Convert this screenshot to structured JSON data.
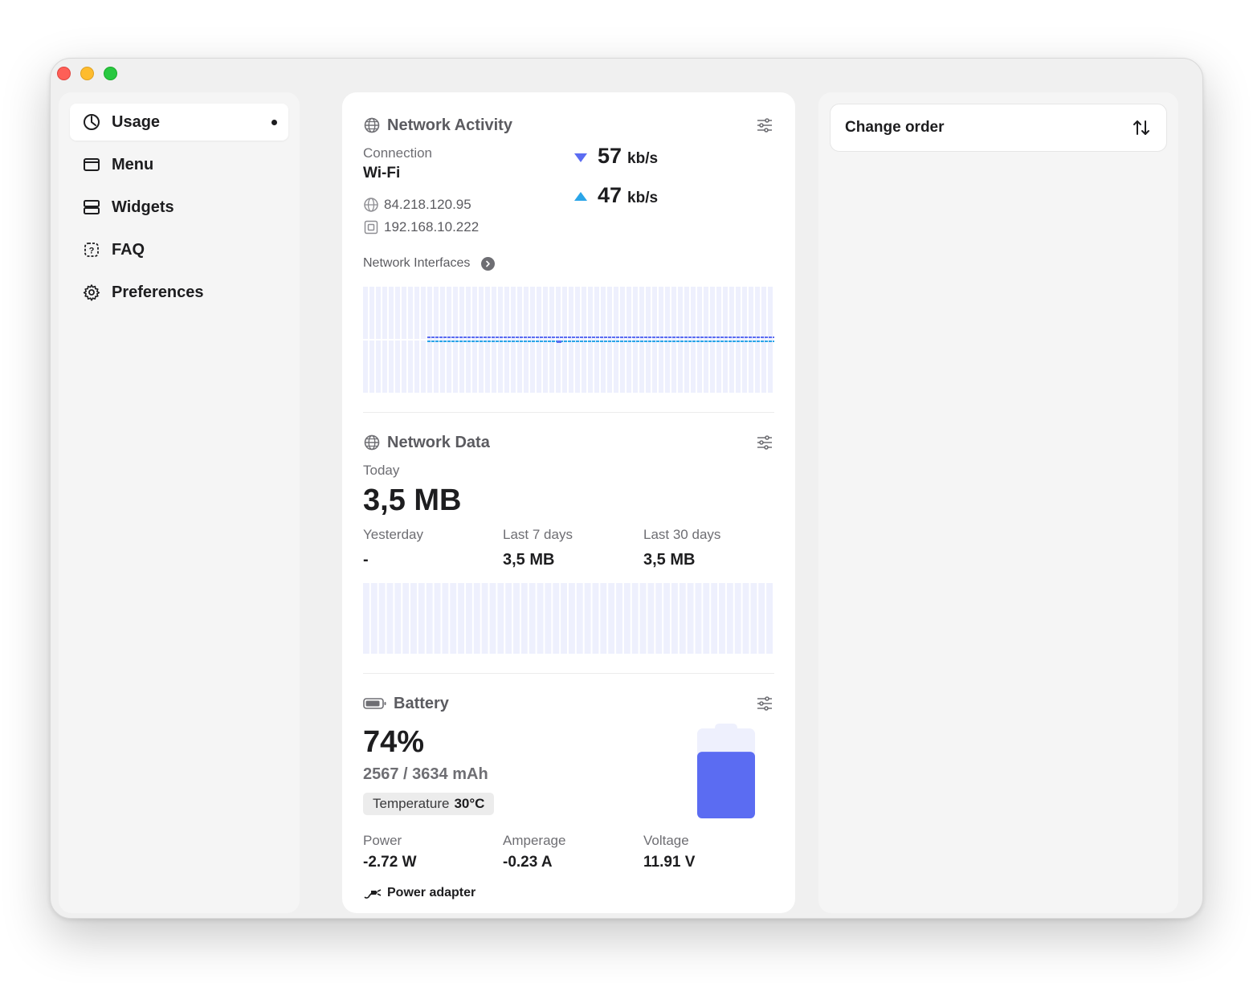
{
  "sidebar": {
    "items": [
      {
        "label": "Usage",
        "icon": "usage-pie-icon",
        "active": true
      },
      {
        "label": "Menu",
        "icon": "menu-window-icon"
      },
      {
        "label": "Widgets",
        "icon": "widgets-stack-icon"
      },
      {
        "label": "FAQ",
        "icon": "faq-question-icon"
      },
      {
        "label": "Preferences",
        "icon": "gear-icon"
      }
    ]
  },
  "network_activity": {
    "title": "Network Activity",
    "connection_label": "Connection",
    "connection_value": "Wi-Fi",
    "public_ip": "84.218.120.95",
    "local_ip": "192.168.10.222",
    "download_value": "57",
    "download_unit": "kb/s",
    "upload_value": "47",
    "upload_unit": "kb/s",
    "interfaces_label": "Network Interfaces"
  },
  "network_data": {
    "title": "Network Data",
    "today_label": "Today",
    "today_value": "3,5 MB",
    "yesterday_label": "Yesterday",
    "yesterday_value": "-",
    "last7_label": "Last 7 days",
    "last7_value": "3,5 MB",
    "last30_label": "Last 30 days",
    "last30_value": "3,5 MB"
  },
  "battery": {
    "title": "Battery",
    "percent": "74%",
    "level": 0.74,
    "capacity": "2567 / 3634 mAh",
    "temp_label": "Temperature",
    "temp_value": "30°C",
    "power_label": "Power",
    "power_value": "-2.72 W",
    "amperage_label": "Amperage",
    "amperage_value": "-0.23 A",
    "voltage_label": "Voltage",
    "voltage_value": "11.91 V",
    "adapter_label": "Power adapter"
  },
  "right_panel": {
    "change_order_label": "Change order"
  },
  "colors": {
    "accent": "#5b6cf2",
    "download": "#5b6cf2",
    "upload": "#2aa5e8",
    "chart_bg": "#eef0fd"
  }
}
